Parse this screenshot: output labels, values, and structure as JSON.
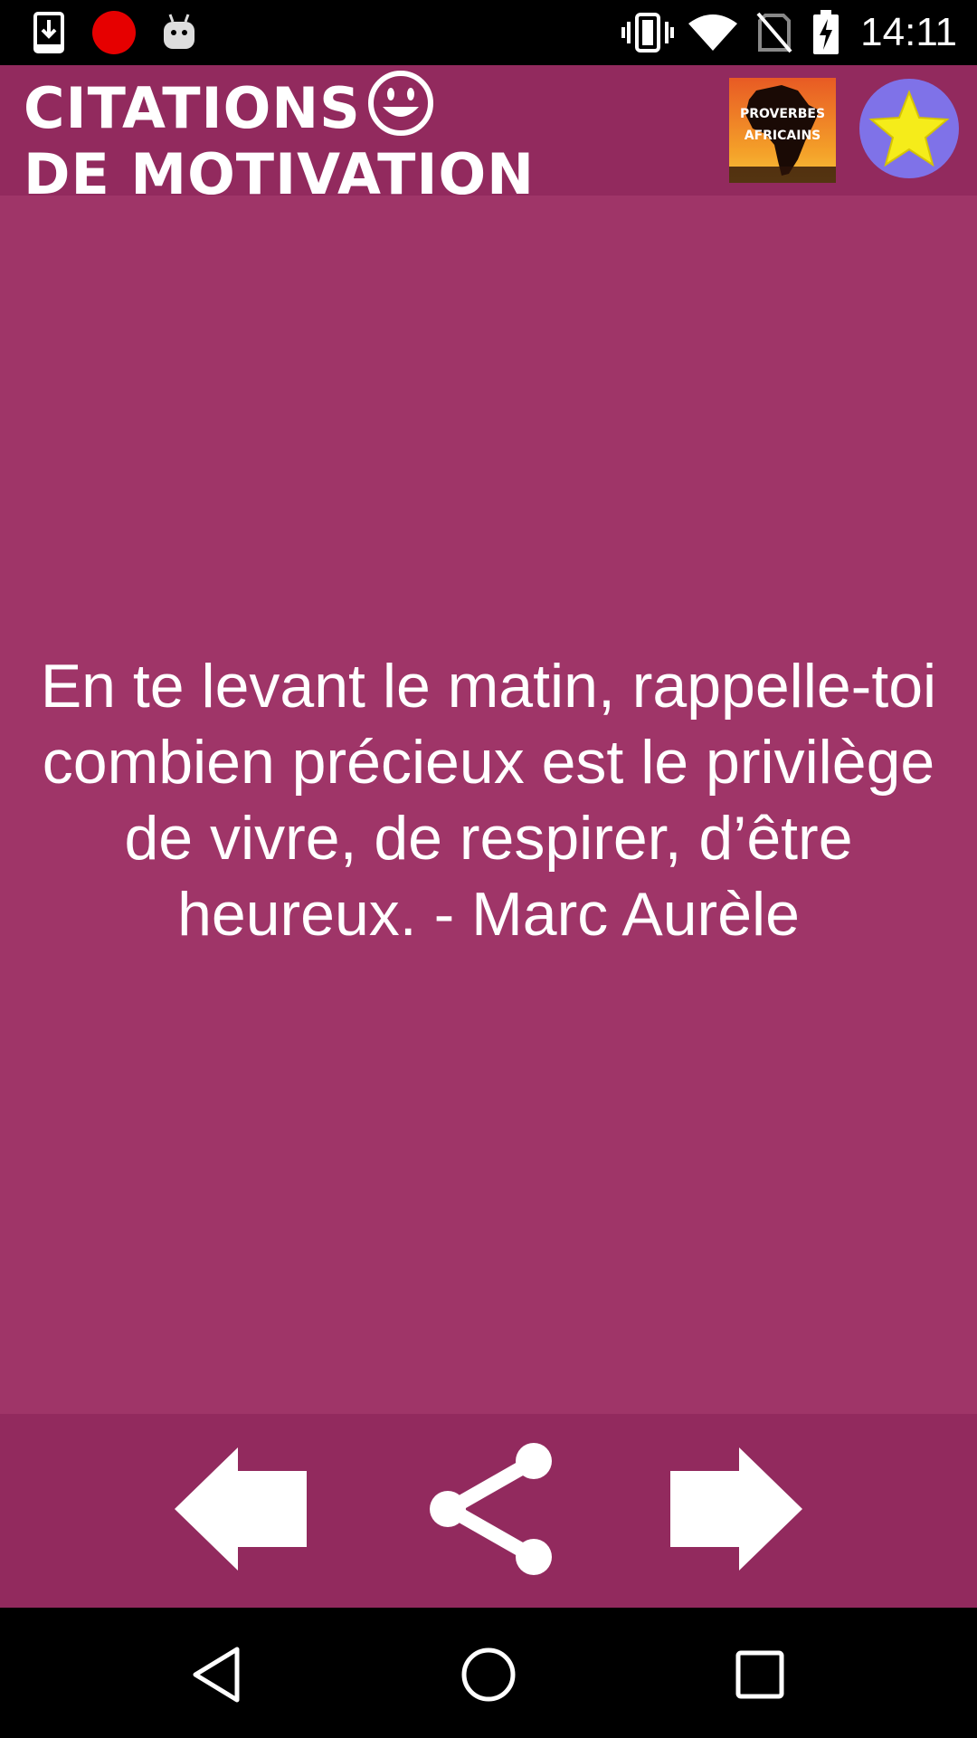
{
  "status_bar": {
    "time": "14:11",
    "icons": [
      "download-icon",
      "record-icon",
      "android-icon",
      "vibrate-icon",
      "wifi-icon",
      "no-sim-icon",
      "battery-charging-icon"
    ]
  },
  "header": {
    "title_line1": "CITATIONS",
    "title_line2": "DE MOTIVATION",
    "title_icon": "smiley-icon",
    "proverbes_logo": {
      "line1": "PROVERBES",
      "line2": "AFRICAINS"
    },
    "favorite_icon": "star-icon"
  },
  "quote": {
    "text": "En te levant le matin, rappelle-toi combien précieux est le privilège de vivre, de respirer, d’être heureux. - Marc Aurèle"
  },
  "toolbar": {
    "previous_icon": "arrow-left-icon",
    "share_icon": "share-icon",
    "next_icon": "arrow-right-icon"
  },
  "system_nav": {
    "back_icon": "back-triangle-icon",
    "home_icon": "home-circle-icon",
    "recents_icon": "recents-square-icon"
  },
  "colors": {
    "header_bg": "#922a5e",
    "content_bg": "#9f3568",
    "star_circle": "#7f72e8",
    "star_fill": "#f5ec1a"
  }
}
